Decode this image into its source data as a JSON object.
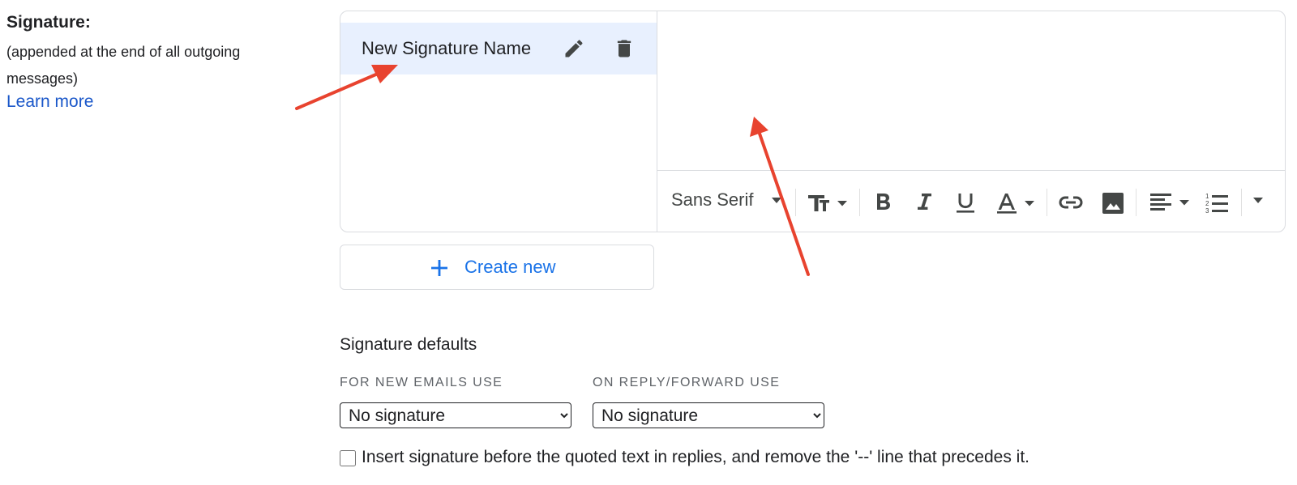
{
  "signature": {
    "title": "Signature:",
    "description": "(appended at the end of all outgoing messages)",
    "learn_more": "Learn more"
  },
  "signature_list": {
    "items": [
      {
        "name": "New Signature Name",
        "edit_icon": "pencil-icon",
        "delete_icon": "trash-icon"
      }
    ]
  },
  "editor": {
    "font": "Sans Serif",
    "toolbar_icons": [
      "text-size-icon",
      "bold-icon",
      "italic-icon",
      "underline-icon",
      "text-color-icon",
      "link-icon",
      "image-icon",
      "align-icon",
      "numbered-list-icon",
      "more-options-icon"
    ]
  },
  "create_new": {
    "label": "Create new",
    "icon": "plus-icon"
  },
  "defaults": {
    "title": "Signature defaults",
    "new_emails_label": "FOR NEW EMAILS USE",
    "new_emails_value": "No signature",
    "reply_label": "ON REPLY/FORWARD USE",
    "reply_value": "No signature"
  },
  "insert_option": {
    "label": "Insert signature before the quoted text in replies, and remove the '--' line that precedes it.",
    "checked": false
  },
  "colors": {
    "accent": "#1a73e8",
    "link": "#1a57c9",
    "selected_bg": "#e8f0fe",
    "annotation_arrow": "#e8432f"
  }
}
